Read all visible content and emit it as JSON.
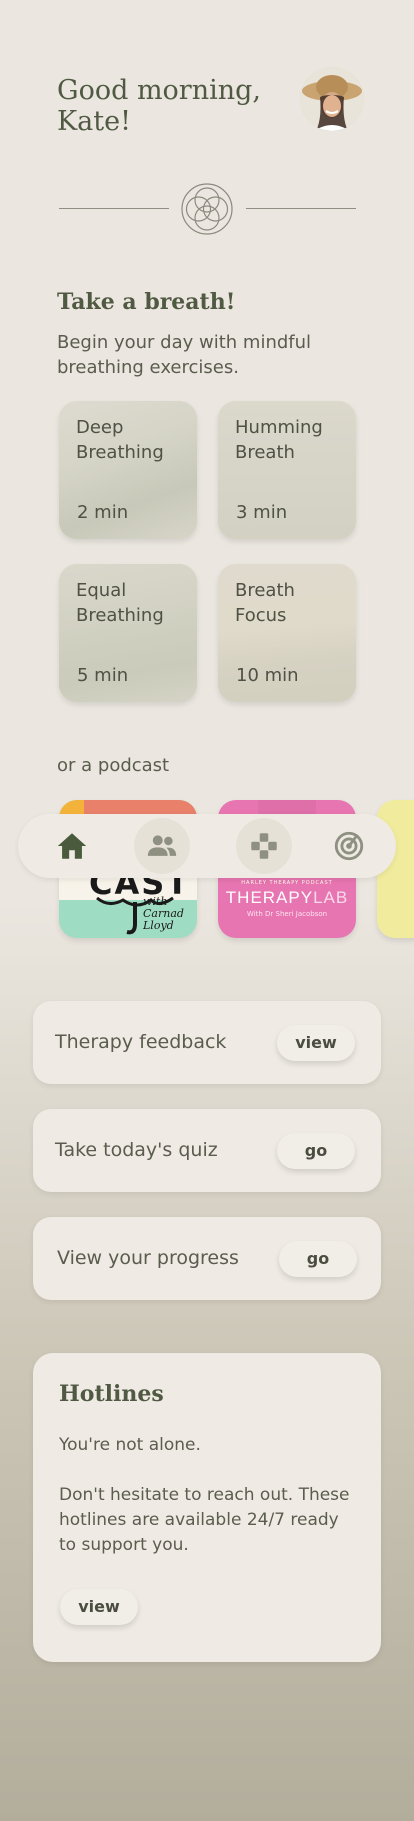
{
  "header": {
    "greeting_line1": "Good morning,",
    "greeting_line2": "Kate!",
    "avatar_icon": "user-avatar"
  },
  "emblem_icon": "flower-of-life-icon",
  "breath": {
    "title": "Take a breath!",
    "subtitle": "Begin your day with mindful breathing exercises.",
    "cards": [
      {
        "name": "Deep Breathing",
        "duration": "2 min"
      },
      {
        "name": "Humming Breath",
        "duration": "3 min"
      },
      {
        "name": "Equal Breathing",
        "duration": "5 min"
      },
      {
        "name": "Breath Focus",
        "duration": "10 min"
      }
    ]
  },
  "podcast": {
    "label": "or a podcast",
    "items": [
      {
        "title": "CAST",
        "byline": "with Carnad Lloyd"
      },
      {
        "kicker": "HARLEY THERAPY PODCAST",
        "title_bold": "THERAPY",
        "title_light": "LAB",
        "host": "With Dr Sheri Jacobson"
      },
      {
        "title": ""
      }
    ]
  },
  "nav": {
    "items": [
      {
        "icon": "home-icon",
        "active": true
      },
      {
        "icon": "people-icon",
        "active": false
      },
      {
        "icon": "gamepad-icon",
        "active": false
      },
      {
        "icon": "radar-icon",
        "active": false
      }
    ]
  },
  "actions": [
    {
      "label": "Therapy feedback",
      "button": "view"
    },
    {
      "label": "Take today's quiz",
      "button": "go"
    },
    {
      "label": "View your progress",
      "button": "go"
    }
  ],
  "hotlines": {
    "title": "Hotlines",
    "line1": "You're not alone.",
    "line2": "Don't hesitate to reach out. These hotlines are available 24/7 ready to support you.",
    "button": "view"
  },
  "colors": {
    "accent_dark": "#4a5a3c",
    "text": "#5a5c4e",
    "surface": "#efebe4"
  }
}
